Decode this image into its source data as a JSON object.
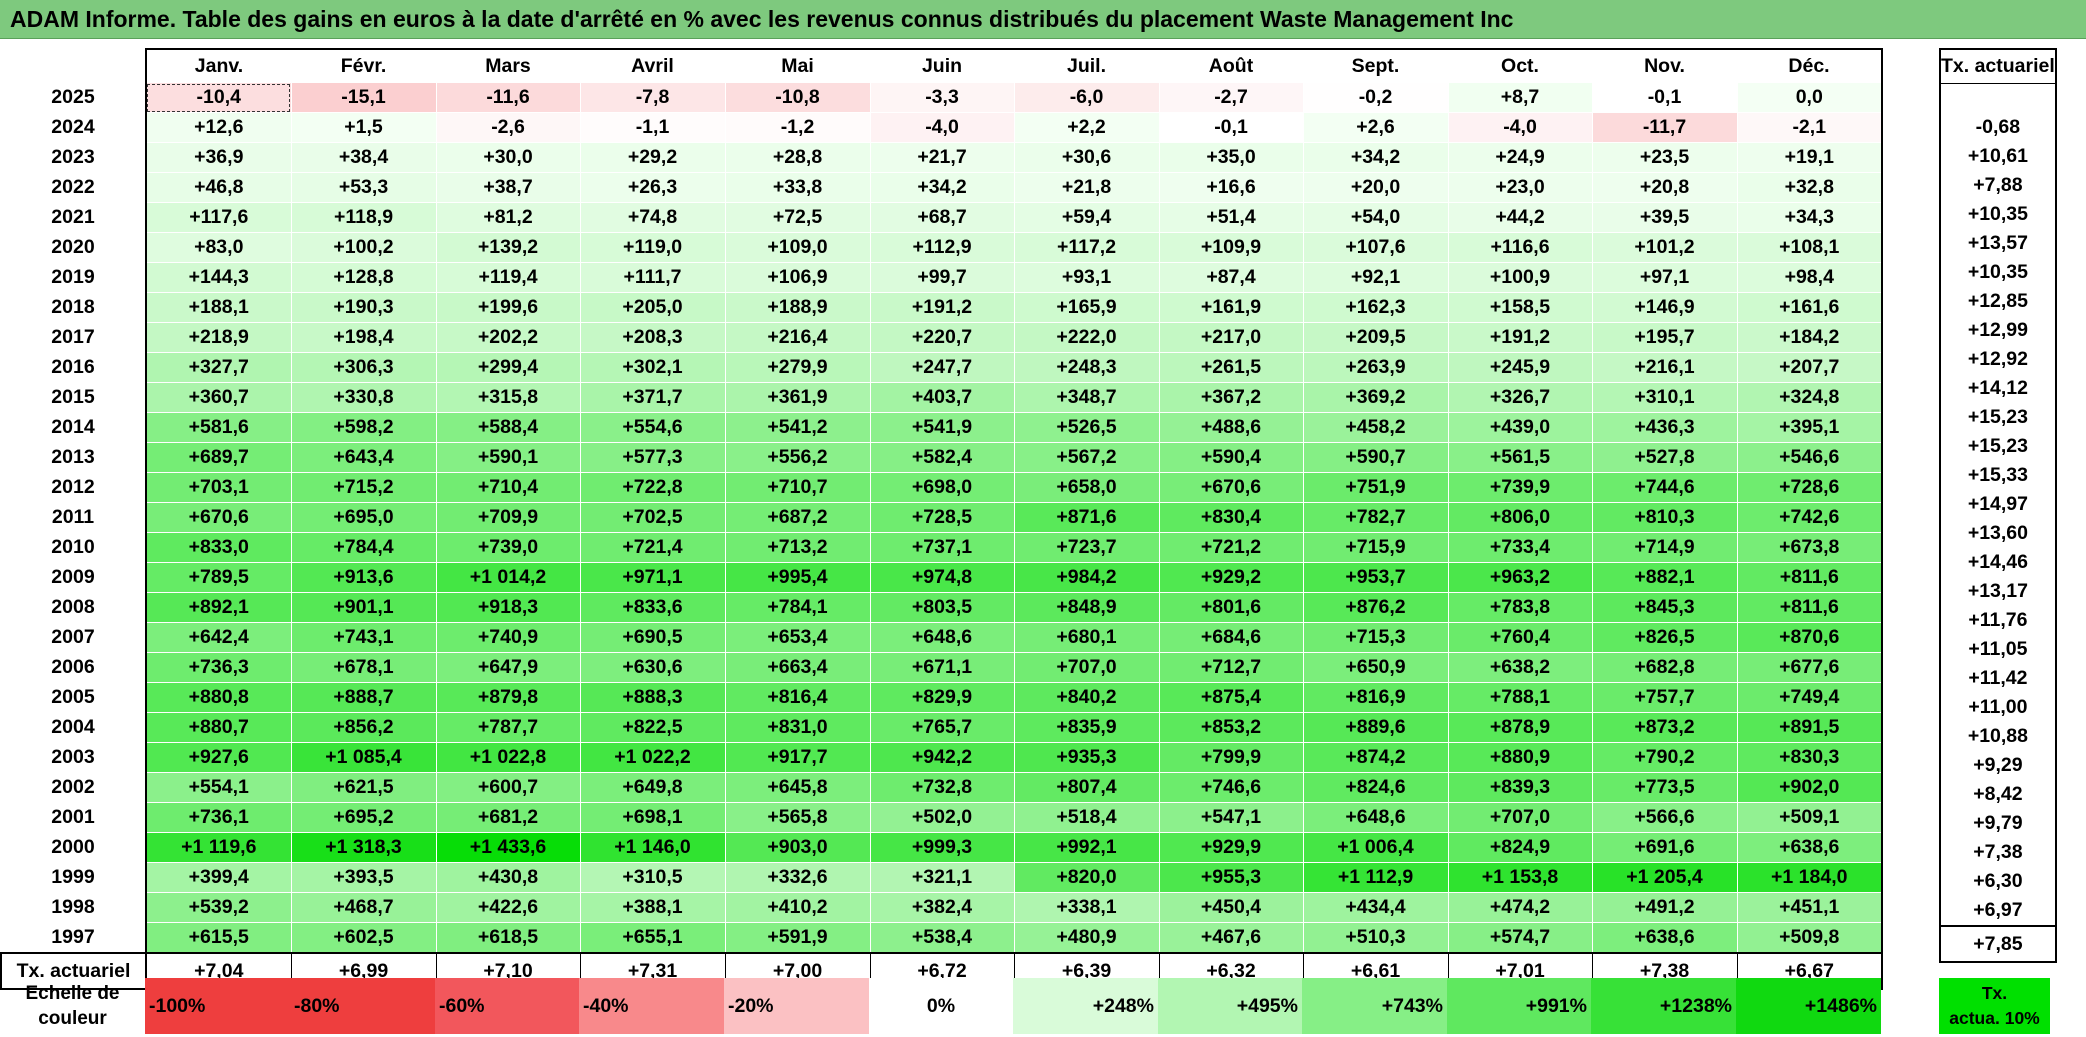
{
  "title": "ADAM Informe. Table des gains en euros à la date d'arrêté en % avec les revenus connus distribués du placement Waste Management Inc",
  "months": [
    "Janv.",
    "Févr.",
    "Mars",
    "Avril",
    "Mai",
    "Juin",
    "Juil.",
    "Août",
    "Sept.",
    "Oct.",
    "Nov.",
    "Déc."
  ],
  "tx_header": "Tx. actuariel",
  "rows": [
    {
      "year": "2025",
      "values": [
        "-10,4",
        "-15,1",
        "-11,6",
        "-7,8",
        "-10,8",
        "-3,3",
        "-6,0",
        "-2,7",
        "-0,2",
        "+8,7",
        "-0,1",
        "0,0"
      ],
      "tx": ""
    },
    {
      "year": "2024",
      "values": [
        "+12,6",
        "+1,5",
        "-2,6",
        "-1,1",
        "-1,2",
        "-4,0",
        "+2,2",
        "-0,1",
        "+2,6",
        "-4,0",
        "-11,7",
        "-2,1"
      ],
      "tx": "-0,68"
    },
    {
      "year": "2023",
      "values": [
        "+36,9",
        "+38,4",
        "+30,0",
        "+29,2",
        "+28,8",
        "+21,7",
        "+30,6",
        "+35,0",
        "+34,2",
        "+24,9",
        "+23,5",
        "+19,1"
      ],
      "tx": "+10,61"
    },
    {
      "year": "2022",
      "values": [
        "+46,8",
        "+53,3",
        "+38,7",
        "+26,3",
        "+33,8",
        "+34,2",
        "+21,8",
        "+16,6",
        "+20,0",
        "+23,0",
        "+20,8",
        "+32,8"
      ],
      "tx": "+7,88"
    },
    {
      "year": "2021",
      "values": [
        "+117,6",
        "+118,9",
        "+81,2",
        "+74,8",
        "+72,5",
        "+68,7",
        "+59,4",
        "+51,4",
        "+54,0",
        "+44,2",
        "+39,5",
        "+34,3"
      ],
      "tx": "+10,35"
    },
    {
      "year": "2020",
      "values": [
        "+83,0",
        "+100,2",
        "+139,2",
        "+119,0",
        "+109,0",
        "+112,9",
        "+117,2",
        "+109,9",
        "+107,6",
        "+116,6",
        "+101,2",
        "+108,1"
      ],
      "tx": "+13,57"
    },
    {
      "year": "2019",
      "values": [
        "+144,3",
        "+128,8",
        "+119,4",
        "+111,7",
        "+106,9",
        "+99,7",
        "+93,1",
        "+87,4",
        "+92,1",
        "+100,9",
        "+97,1",
        "+98,4"
      ],
      "tx": "+10,35"
    },
    {
      "year": "2018",
      "values": [
        "+188,1",
        "+190,3",
        "+199,6",
        "+205,0",
        "+188,9",
        "+191,2",
        "+165,9",
        "+161,9",
        "+162,3",
        "+158,5",
        "+146,9",
        "+161,6"
      ],
      "tx": "+12,85"
    },
    {
      "year": "2017",
      "values": [
        "+218,9",
        "+198,4",
        "+202,2",
        "+208,3",
        "+216,4",
        "+220,7",
        "+222,0",
        "+217,0",
        "+209,5",
        "+191,2",
        "+195,7",
        "+184,2"
      ],
      "tx": "+12,99"
    },
    {
      "year": "2016",
      "values": [
        "+327,7",
        "+306,3",
        "+299,4",
        "+302,1",
        "+279,9",
        "+247,7",
        "+248,3",
        "+261,5",
        "+263,9",
        "+245,9",
        "+216,1",
        "+207,7"
      ],
      "tx": "+12,92"
    },
    {
      "year": "2015",
      "values": [
        "+360,7",
        "+330,8",
        "+315,8",
        "+371,7",
        "+361,9",
        "+403,7",
        "+348,7",
        "+367,2",
        "+369,2",
        "+326,7",
        "+310,1",
        "+324,8"
      ],
      "tx": "+14,12"
    },
    {
      "year": "2014",
      "values": [
        "+581,6",
        "+598,2",
        "+588,4",
        "+554,6",
        "+541,2",
        "+541,9",
        "+526,5",
        "+488,6",
        "+458,2",
        "+439,0",
        "+436,3",
        "+395,1"
      ],
      "tx": "+15,23"
    },
    {
      "year": "2013",
      "values": [
        "+689,7",
        "+643,4",
        "+590,1",
        "+577,3",
        "+556,2",
        "+582,4",
        "+567,2",
        "+590,4",
        "+590,7",
        "+561,5",
        "+527,8",
        "+546,6"
      ],
      "tx": "+15,23"
    },
    {
      "year": "2012",
      "values": [
        "+703,1",
        "+715,2",
        "+710,4",
        "+722,8",
        "+710,7",
        "+698,0",
        "+658,0",
        "+670,6",
        "+751,9",
        "+739,9",
        "+744,6",
        "+728,6"
      ],
      "tx": "+15,33"
    },
    {
      "year": "2011",
      "values": [
        "+670,6",
        "+695,0",
        "+709,9",
        "+702,5",
        "+687,2",
        "+728,5",
        "+871,6",
        "+830,4",
        "+782,7",
        "+806,0",
        "+810,3",
        "+742,6"
      ],
      "tx": "+14,97"
    },
    {
      "year": "2010",
      "values": [
        "+833,0",
        "+784,4",
        "+739,0",
        "+721,4",
        "+713,2",
        "+737,1",
        "+723,7",
        "+721,2",
        "+715,9",
        "+733,4",
        "+714,9",
        "+673,8"
      ],
      "tx": "+13,60"
    },
    {
      "year": "2009",
      "values": [
        "+789,5",
        "+913,6",
        "+1 014,2",
        "+971,1",
        "+995,4",
        "+974,8",
        "+984,2",
        "+929,2",
        "+953,7",
        "+963,2",
        "+882,1",
        "+811,6"
      ],
      "tx": "+14,46"
    },
    {
      "year": "2008",
      "values": [
        "+892,1",
        "+901,1",
        "+918,3",
        "+833,6",
        "+784,1",
        "+803,5",
        "+848,9",
        "+801,6",
        "+876,2",
        "+783,8",
        "+845,3",
        "+811,6"
      ],
      "tx": "+13,17"
    },
    {
      "year": "2007",
      "values": [
        "+642,4",
        "+743,1",
        "+740,9",
        "+690,5",
        "+653,4",
        "+648,6",
        "+680,1",
        "+684,6",
        "+715,3",
        "+760,4",
        "+826,5",
        "+870,6"
      ],
      "tx": "+11,76"
    },
    {
      "year": "2006",
      "values": [
        "+736,3",
        "+678,1",
        "+647,9",
        "+630,6",
        "+663,4",
        "+671,1",
        "+707,0",
        "+712,7",
        "+650,9",
        "+638,2",
        "+682,8",
        "+677,6"
      ],
      "tx": "+11,05"
    },
    {
      "year": "2005",
      "values": [
        "+880,8",
        "+888,7",
        "+879,8",
        "+888,3",
        "+816,4",
        "+829,9",
        "+840,2",
        "+875,4",
        "+816,9",
        "+788,1",
        "+757,7",
        "+749,4"
      ],
      "tx": "+11,42"
    },
    {
      "year": "2004",
      "values": [
        "+880,7",
        "+856,2",
        "+787,7",
        "+822,5",
        "+831,0",
        "+765,7",
        "+835,9",
        "+853,2",
        "+889,6",
        "+878,9",
        "+873,2",
        "+891,5"
      ],
      "tx": "+11,00"
    },
    {
      "year": "2003",
      "values": [
        "+927,6",
        "+1 085,4",
        "+1 022,8",
        "+1 022,2",
        "+917,7",
        "+942,2",
        "+935,3",
        "+799,9",
        "+874,2",
        "+880,9",
        "+790,2",
        "+830,3"
      ],
      "tx": "+10,88"
    },
    {
      "year": "2002",
      "values": [
        "+554,1",
        "+621,5",
        "+600,7",
        "+649,8",
        "+645,8",
        "+732,8",
        "+807,4",
        "+746,6",
        "+824,6",
        "+839,3",
        "+773,5",
        "+902,0"
      ],
      "tx": "+9,29"
    },
    {
      "year": "2001",
      "values": [
        "+736,1",
        "+695,2",
        "+681,2",
        "+698,1",
        "+565,8",
        "+502,0",
        "+518,4",
        "+547,1",
        "+648,6",
        "+707,0",
        "+566,6",
        "+509,1"
      ],
      "tx": "+8,42"
    },
    {
      "year": "2000",
      "values": [
        "+1 119,6",
        "+1 318,3",
        "+1 433,6",
        "+1 146,0",
        "+903,0",
        "+999,3",
        "+992,1",
        "+929,9",
        "+1 006,4",
        "+824,9",
        "+691,6",
        "+638,6"
      ],
      "tx": "+9,79"
    },
    {
      "year": "1999",
      "values": [
        "+399,4",
        "+393,5",
        "+430,8",
        "+310,5",
        "+332,6",
        "+321,1",
        "+820,0",
        "+955,3",
        "+1 112,9",
        "+1 153,8",
        "+1 205,4",
        "+1 184,0"
      ],
      "tx": "+7,38"
    },
    {
      "year": "1998",
      "values": [
        "+539,2",
        "+468,7",
        "+422,6",
        "+388,1",
        "+410,2",
        "+382,4",
        "+338,1",
        "+450,4",
        "+434,4",
        "+474,2",
        "+491,2",
        "+451,1"
      ],
      "tx": "+6,30"
    },
    {
      "year": "1997",
      "values": [
        "+615,5",
        "+602,5",
        "+618,5",
        "+655,1",
        "+591,9",
        "+538,4",
        "+480,9",
        "+467,6",
        "+510,3",
        "+574,7",
        "+638,6",
        "+509,8"
      ],
      "tx": "+6,97"
    }
  ],
  "total": {
    "label": "Tx. actuariel",
    "values": [
      "+7,04",
      "+6,99",
      "+7,10",
      "+7,31",
      "+7,00",
      "+6,72",
      "+6,39",
      "+6,32",
      "+6,61",
      "+7,01",
      "+7,38",
      "+6,67"
    ],
    "tx": "+7,85"
  },
  "scale": {
    "label_line1": "Echelle de",
    "label_line2": "couleur",
    "items": [
      {
        "label": "-100%",
        "color": "#ee3e3e"
      },
      {
        "label": "-80%",
        "color": "#ee3e3e"
      },
      {
        "label": "-60%",
        "color": "#f2575c"
      },
      {
        "label": "-40%",
        "color": "#f8898b"
      },
      {
        "label": "-20%",
        "color": "#fbc1c3"
      },
      {
        "label": "0%",
        "color": "#ffffff"
      },
      {
        "label": "+248%",
        "color": "#d9fbd9"
      },
      {
        "label": "+495%",
        "color": "#b2f6b2"
      },
      {
        "label": "+743%",
        "color": "#86ef86"
      },
      {
        "label": "+991%",
        "color": "#5fe85f"
      },
      {
        "label": "+1238%",
        "color": "#37e137"
      },
      {
        "label": "+1486%",
        "color": "#10d910"
      }
    ],
    "last_line1": "Tx.",
    "last_line2": "actua. 10%"
  },
  "colors": {
    "title_bg": "#7ec97e",
    "neg_max": "#f24a4a",
    "pos_max": "#00dc00"
  }
}
